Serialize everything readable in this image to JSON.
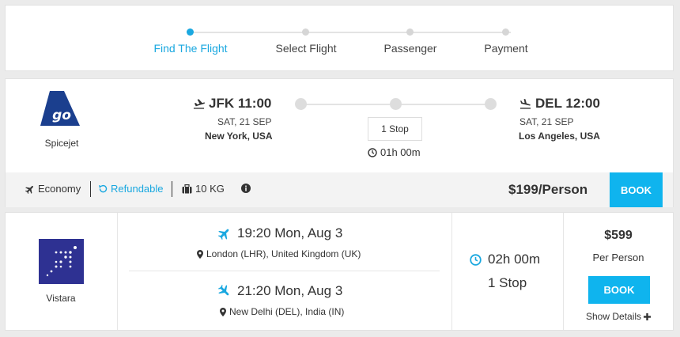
{
  "stepper": {
    "steps": [
      {
        "label": "Find The Flight",
        "active": true
      },
      {
        "label": "Select Flight",
        "active": false
      },
      {
        "label": "Passenger",
        "active": false
      },
      {
        "label": "Payment",
        "active": false
      }
    ]
  },
  "flight1": {
    "airline": {
      "name": "Spicejet",
      "logo_icon": "go-air-logo"
    },
    "departure": {
      "code_time": "JFK 11:00",
      "date": "SAT, 21 SEP",
      "city": "New York, USA"
    },
    "arrival": {
      "code_time": "DEL 12:00",
      "date": "SAT, 21 SEP",
      "city": "Los Angeles, USA"
    },
    "stops": "1 Stop",
    "duration": "01h 00m",
    "cabin": "Economy",
    "refundable": "Refundable",
    "baggage": "10 KG",
    "price": "$199/Person",
    "book_label": "BOOK"
  },
  "flight2": {
    "airline": {
      "name": "Vistara",
      "logo_icon": "vistara-logo"
    },
    "outbound": {
      "time": "19:20 Mon, Aug 3",
      "place": "London (LHR), United Kingdom (UK)"
    },
    "inbound": {
      "time": "21:20 Mon, Aug 3",
      "place": "New Delhi (DEL), India (IN)"
    },
    "duration": "02h 00m",
    "stops": "1 Stop",
    "price": "$599",
    "per_person": "Per Person",
    "book_label": "BOOK",
    "details_label": "Show Details"
  },
  "colors": {
    "accent": "#1aa8e0",
    "book_button": "#0fb4ee",
    "vistara_bg": "#2e3192",
    "goair_blue": "#1b3f8e"
  }
}
